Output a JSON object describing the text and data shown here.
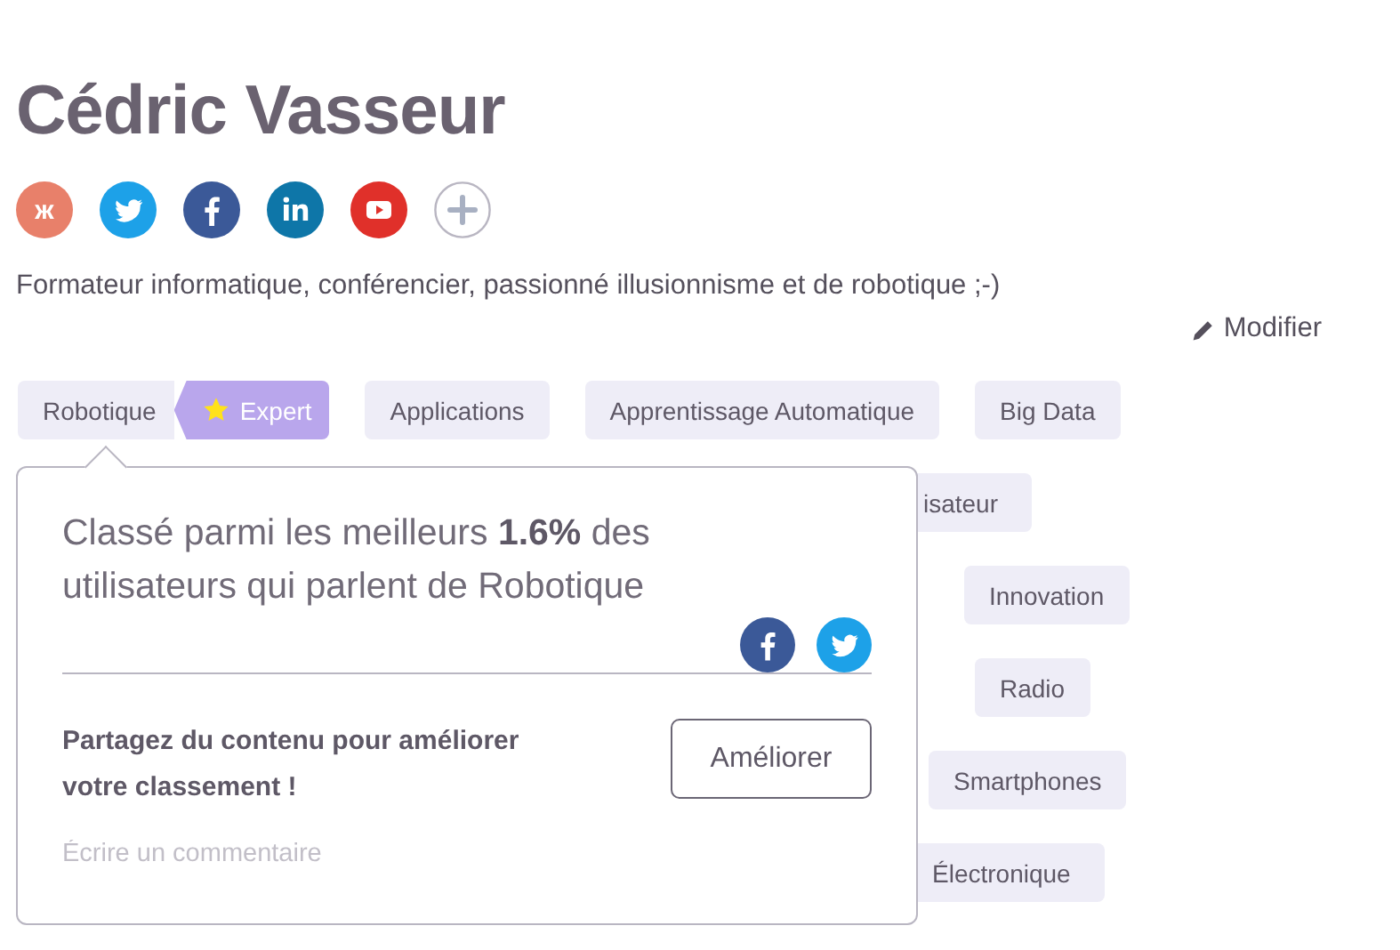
{
  "profile": {
    "name": "Cédric Vasseur",
    "bio": "Formateur informatique, conférencier, passionné illusionnisme et de robotique ;-)",
    "edit_link": "Modifier"
  },
  "social_links": [
    {
      "kind": "glyph",
      "text": "ж"
    },
    {
      "kind": "twitter"
    },
    {
      "kind": "facebook"
    },
    {
      "kind": "linkedin"
    },
    {
      "kind": "youtube"
    },
    {
      "kind": "add"
    }
  ],
  "topic_rows": [
    {
      "tags": [
        {
          "label": "Robotique",
          "badge": "Expert"
        },
        {
          "label": "Applications"
        },
        {
          "label": "Apprentissage Automatique"
        },
        {
          "label": "Big Data"
        }
      ]
    },
    {
      "tags": [
        {
          "label": "isateur"
        }
      ]
    },
    {
      "tags": [
        {
          "label": "Innovation"
        }
      ]
    },
    {
      "tags": [
        {
          "label": "Radio"
        }
      ]
    },
    {
      "tags": [
        {
          "label": "Smartphones"
        }
      ]
    },
    {
      "tags": [
        {
          "label": "Électronique"
        }
      ]
    }
  ],
  "popover": {
    "ranking": "Classé parmi les meilleurs **1.6%** des utilisateurs qui parlent de Robotique",
    "share_icons": [
      {
        "kind": "facebook"
      },
      {
        "kind": "twitter"
      }
    ],
    "prompt": "Partagez du contenu pour améliorer votre classement !",
    "button": "Améliorer",
    "comment": {
      "placeholder": "Écrire un commentaire"
    }
  }
}
